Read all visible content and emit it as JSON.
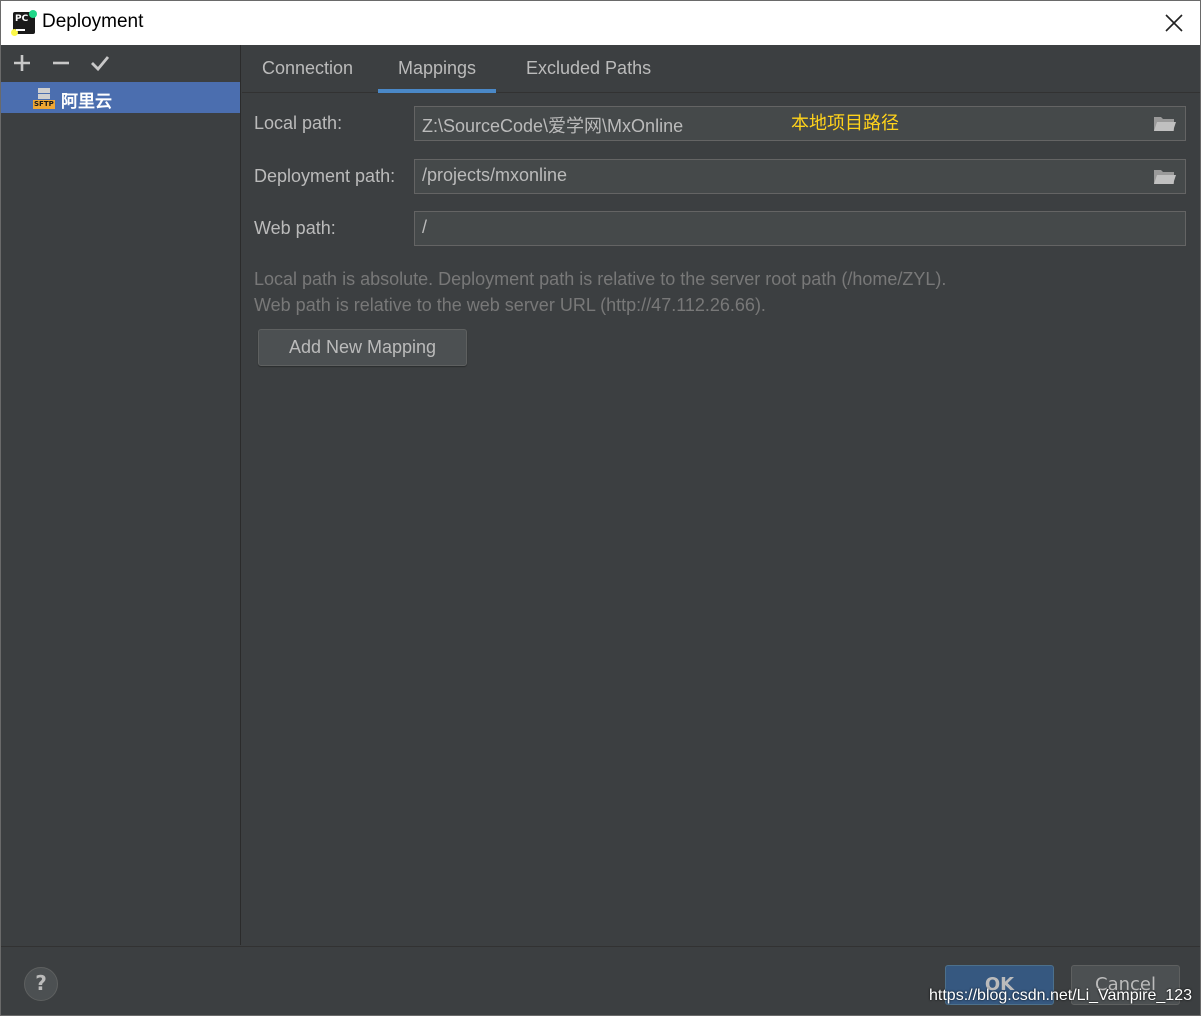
{
  "window": {
    "title": "Deployment"
  },
  "left": {
    "server": {
      "name": "阿里云",
      "type_badge": "SFTP"
    }
  },
  "tabs": [
    {
      "label": "Connection"
    },
    {
      "label": "Mappings"
    },
    {
      "label": "Excluded Paths"
    }
  ],
  "mappings": {
    "local_path": {
      "label": "Local path:",
      "value": "Z:\\SourceCode\\爱学网\\MxOnline",
      "annotation": "本地项目路径"
    },
    "deployment_path": {
      "label": "Deployment path:",
      "value": "/projects/mxonline"
    },
    "web_path": {
      "label": "Web path:",
      "value": "/"
    },
    "hint_line1": "Local path is absolute. Deployment path is relative to the server root path (/home/ZYL).",
    "hint_line2": "Web path is relative to the web server URL (http://47.112.26.66).",
    "add_button": "Add New Mapping"
  },
  "footer": {
    "help": "?",
    "ok": "OK",
    "cancel": "Cancel",
    "watermark": "https://blog.csdn.net/Li_Vampire_123"
  },
  "colors": {
    "accent": "#4a88c7",
    "selection": "#4b6eaf",
    "annotation": "#ffd21a"
  },
  "icons": {
    "add": "plus-icon",
    "remove": "minus-icon",
    "default": "check-icon",
    "folder": "folder-icon",
    "close": "close-icon"
  }
}
